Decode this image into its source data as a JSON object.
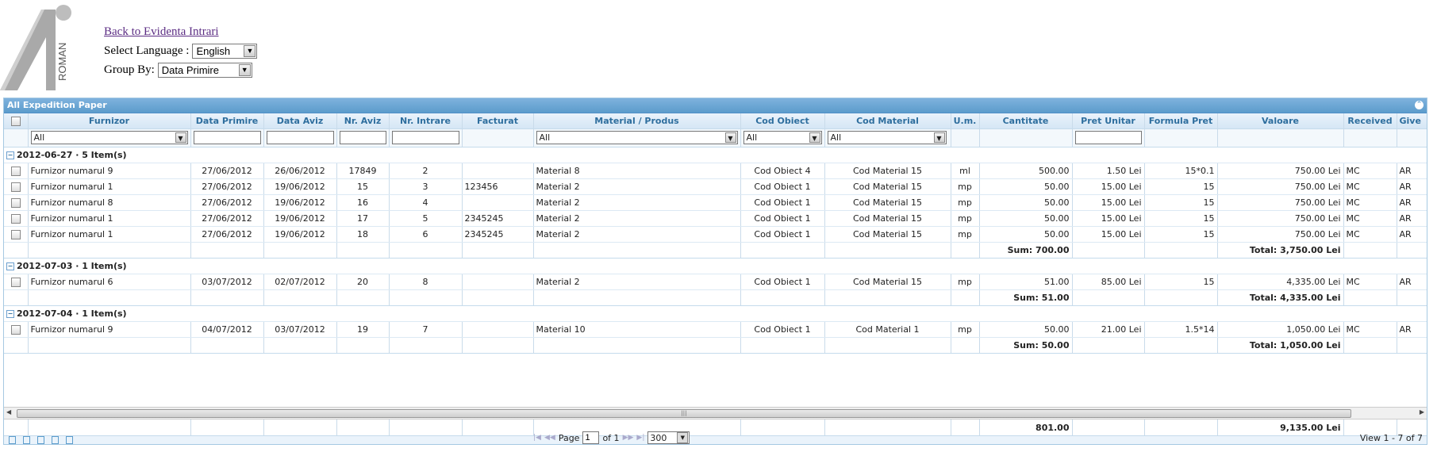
{
  "logo": {
    "text": "ROMAN"
  },
  "header": {
    "back_link": "Back to Evidenta Intrari",
    "language_label": "Select Language :",
    "language_value": "English",
    "group_label": "Group By:",
    "group_value": "Data Primire"
  },
  "grid": {
    "caption": "All Expedition Paper",
    "columns": [
      "Furnizor",
      "Data Primire",
      "Data Aviz",
      "Nr. Aviz",
      "Nr. Intrare",
      "Facturat",
      "Material / Produs",
      "Cod Obiect",
      "Cod Material",
      "U.m.",
      "Cantitate",
      "Pret Unitar",
      "Formula Pret",
      "Valoare",
      "Received",
      "Give"
    ],
    "filters": {
      "furnizor": "All",
      "material": "All",
      "cod_obiect": "All",
      "cod_material": "All"
    },
    "groups": [
      {
        "label": "2012-06-27 · 5 Item(s)",
        "rows": [
          [
            "Furnizor numarul 9",
            "27/06/2012",
            "26/06/2012",
            "17849",
            "2",
            "",
            "Material 8",
            "Cod Obiect 4",
            "Cod Material 15",
            "ml",
            "500.00",
            "1.50 Lei",
            "15*0.1",
            "750.00 Lei",
            "MC",
            "AR"
          ],
          [
            "Furnizor numarul 1",
            "27/06/2012",
            "19/06/2012",
            "15",
            "3",
            "123456",
            "Material 2",
            "Cod Obiect 1",
            "Cod Material 15",
            "mp",
            "50.00",
            "15.00 Lei",
            "15",
            "750.00 Lei",
            "MC",
            "AR"
          ],
          [
            "Furnizor numarul 8",
            "27/06/2012",
            "19/06/2012",
            "16",
            "4",
            "",
            "Material 2",
            "Cod Obiect 1",
            "Cod Material 15",
            "mp",
            "50.00",
            "15.00 Lei",
            "15",
            "750.00 Lei",
            "MC",
            "AR"
          ],
          [
            "Furnizor numarul 1",
            "27/06/2012",
            "19/06/2012",
            "17",
            "5",
            "2345245",
            "Material 2",
            "Cod Obiect 1",
            "Cod Material 15",
            "mp",
            "50.00",
            "15.00 Lei",
            "15",
            "750.00 Lei",
            "MC",
            "AR"
          ],
          [
            "Furnizor numarul 1",
            "27/06/2012",
            "19/06/2012",
            "18",
            "6",
            "2345245",
            "Material 2",
            "Cod Obiect 1",
            "Cod Material 15",
            "mp",
            "50.00",
            "15.00 Lei",
            "15",
            "750.00 Lei",
            "MC",
            "AR"
          ]
        ],
        "sum": "Sum: 700.00",
        "total": "Total: 3,750.00 Lei"
      },
      {
        "label": "2012-07-03 · 1 Item(s)",
        "rows": [
          [
            "Furnizor numarul 6",
            "03/07/2012",
            "02/07/2012",
            "20",
            "8",
            "",
            "Material 2",
            "Cod Obiect 1",
            "Cod Material 15",
            "mp",
            "51.00",
            "85.00 Lei",
            "15",
            "4,335.00 Lei",
            "MC",
            "AR"
          ]
        ],
        "sum": "Sum: 51.00",
        "total": "Total: 4,335.00 Lei"
      },
      {
        "label": "2012-07-04 · 1 Item(s)",
        "rows": [
          [
            "Furnizor numarul 9",
            "04/07/2012",
            "03/07/2012",
            "19",
            "7",
            "",
            "Material 10",
            "Cod Obiect 1",
            "Cod Material 1",
            "mp",
            "50.00",
            "21.00 Lei",
            "1.5*14",
            "1,050.00 Lei",
            "MC",
            "AR"
          ]
        ],
        "sum": "Sum: 50.00",
        "total": "Total: 1,050.00 Lei"
      }
    ],
    "footer": {
      "cantitate": "801.00",
      "valoare": "9,135.00 Lei"
    }
  },
  "pager": {
    "page_label": "Page",
    "page_value": "1",
    "of_label": "of 1",
    "rows_value": "300",
    "view_text": "View 1 - 7 of 7",
    "icons": [
      "add-icon",
      "search-icon",
      "refresh-icon",
      "columns-icon",
      "print-icon"
    ]
  },
  "colors": {
    "header_blue": "#5c9ccc",
    "header_text": "#2e6e9e",
    "link": "#5b2c83"
  }
}
